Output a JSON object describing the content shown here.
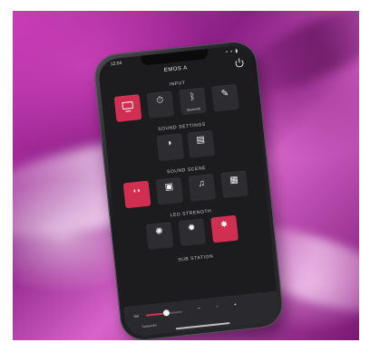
{
  "status": {
    "time": "12:04",
    "icons": "▪ ▪ ▮"
  },
  "app": {
    "title": "EMOS A"
  },
  "sections": {
    "input": "INPUT",
    "sound_settings": "SOUND SETTINGS",
    "sound_scene": "SOUND SCENE",
    "led_strength": "LED STRENGTH",
    "sub_station": "SUB STATION"
  },
  "input_buttons": [
    {
      "label": "",
      "icon": "tv-icon",
      "active": true
    },
    {
      "label": "",
      "icon": "timer-icon",
      "glyph": "⏱",
      "active": false
    },
    {
      "label": "Bluetooth",
      "icon": "bluetooth-icon",
      "glyph": "ᛒ",
      "active": false
    },
    {
      "label": "",
      "icon": "plug-icon",
      "glyph": "✎",
      "active": false
    }
  ],
  "sound_settings_buttons": [
    {
      "label": "",
      "icon": "speaker-icon",
      "glyph": "◗",
      "active": false
    },
    {
      "label": "",
      "icon": "equalizer-icon",
      "glyph": "▤",
      "active": false
    }
  ],
  "sound_scene_buttons": [
    {
      "label": "",
      "icon": "surround-icon",
      "glyph": "◖◗",
      "active": true
    },
    {
      "label": "",
      "icon": "movie-icon",
      "glyph": "▣",
      "active": false
    },
    {
      "label": "",
      "icon": "music-icon",
      "glyph": "♫",
      "active": false
    },
    {
      "label": "",
      "icon": "game-icon",
      "glyph": "▦",
      "active": false
    }
  ],
  "led_buttons": [
    {
      "label": "",
      "icon": "led-off-icon",
      "glyph": "✺",
      "active": false
    },
    {
      "label": "",
      "icon": "led-low-icon",
      "glyph": "✹",
      "active": false
    },
    {
      "label": "",
      "icon": "led-high-icon",
      "glyph": "✸",
      "active": true
    }
  ],
  "bottom": {
    "volume_label": "Vol",
    "volume_level": 0.55,
    "sub_label": "Subwoofer"
  },
  "colors": {
    "accent": "#d12f52",
    "panel": "#1c1c1f",
    "button": "#2d2d31"
  }
}
